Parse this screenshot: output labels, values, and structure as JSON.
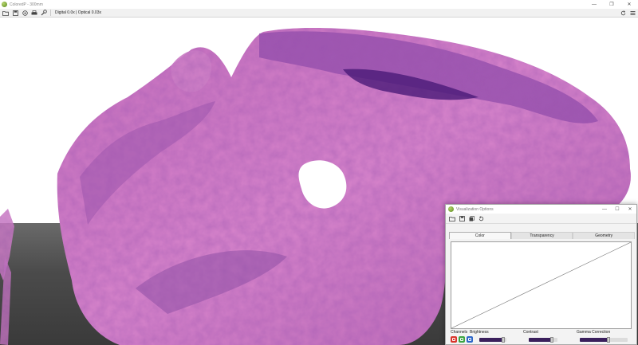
{
  "app": {
    "title": "ColoredP - 300mm"
  },
  "window_controls": {
    "minimize": "—",
    "maximize": "❐",
    "close": "✕"
  },
  "toolbar": {
    "icons": [
      "folder-open-icon",
      "save-icon",
      "settings-icon",
      "print-icon",
      "wrench-icon"
    ],
    "zoom_label": "Digital 0.0x | Optical 0.03x",
    "right_icons": [
      "refresh-icon",
      "menu-icon"
    ]
  },
  "viewport": {
    "floor_color": "#4b4b4b",
    "tissue_colors": {
      "pink": "#d782c8",
      "purple": "#8a4aa8",
      "dark": "#4a1a78"
    }
  },
  "dialog": {
    "title": "Visualization Options",
    "controls": {
      "minimize": "—",
      "maximize": "☐",
      "close": "✕"
    },
    "toolbar_icons": [
      "folder-open-icon",
      "save-icon",
      "copy-icon",
      "reset-icon"
    ],
    "tabs": [
      {
        "label": "Color",
        "active": true
      },
      {
        "label": "Transparency",
        "active": false
      },
      {
        "label": "Geometry",
        "active": false
      }
    ],
    "labels": {
      "channels": "Channels",
      "brightness": "Brightness",
      "contrast": "Contrast",
      "gamma": "Gamma Correction"
    },
    "channels": [
      "red",
      "green",
      "blue"
    ],
    "brightness_value": 0.88,
    "contrast_value": 0.8,
    "gamma_value": 0.6,
    "slider_color": "#3a1f5c"
  }
}
